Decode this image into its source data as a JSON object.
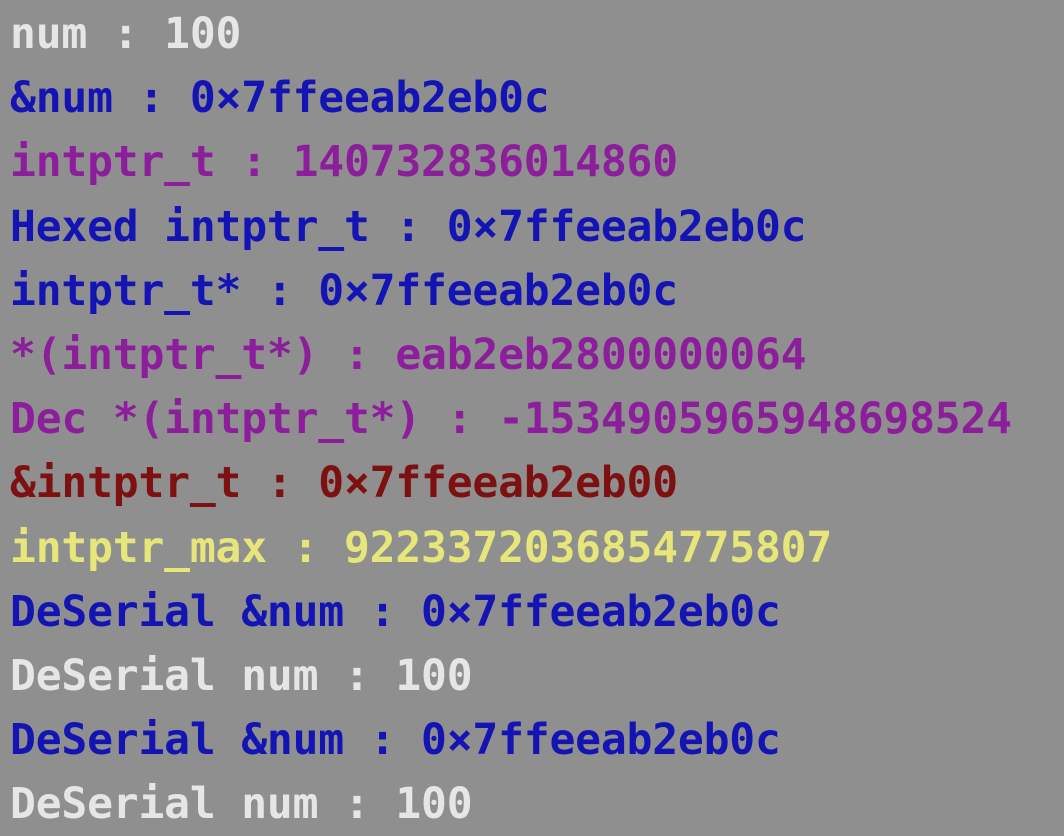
{
  "colors": {
    "background": "#8f8f8f",
    "white": "#e6e6e6",
    "blue": "#1414b4",
    "purple": "#8c1e9c",
    "dark_red": "#7d1010",
    "yellow": "#e6e67a"
  },
  "lines": [
    {
      "text": "num : 100",
      "color": "#e6e6e6"
    },
    {
      "text": "&num : 0×7ffeeab2eb0c",
      "color": "#1414b4"
    },
    {
      "text": "intptr_t : 140732836014860",
      "color": "#8c1e9c"
    },
    {
      "text": "Hexed intptr_t : 0×7ffeeab2eb0c",
      "color": "#1414b4"
    },
    {
      "text": "intptr_t* : 0×7ffeeab2eb0c",
      "color": "#1414b4"
    },
    {
      "text": "*(intptr_t*) : eab2eb2800000064",
      "color": "#8c1e9c"
    },
    {
      "text": "Dec *(intptr_t*) : -1534905965948698524",
      "color": "#8c1e9c"
    },
    {
      "text": "&intptr_t : 0×7ffeeab2eb00",
      "color": "#7d1010"
    },
    {
      "text": "intptr_max : 9223372036854775807",
      "color": "#e6e67a"
    },
    {
      "text": "DeSerial &num : 0×7ffeeab2eb0c",
      "color": "#1414b4"
    },
    {
      "text": "DeSerial num : 100",
      "color": "#e6e6e6"
    },
    {
      "text": "DeSerial &num : 0×7ffeeab2eb0c",
      "color": "#1414b4"
    },
    {
      "text": "DeSerial num : 100",
      "color": "#e6e6e6"
    }
  ]
}
